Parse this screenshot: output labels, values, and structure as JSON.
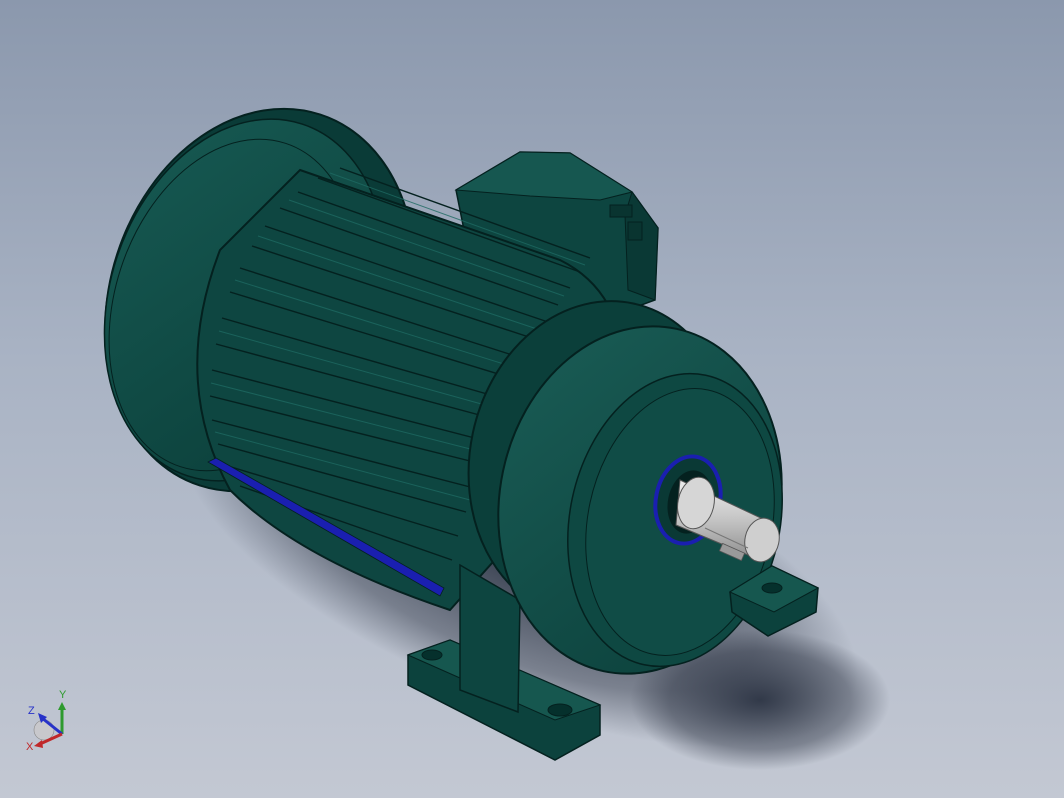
{
  "viewport": {
    "background_top": "#8b98ad",
    "background_bottom": "#c3c8d3"
  },
  "model": {
    "body_color": "#0f4a44",
    "body_light": "#1b5e57",
    "body_dark": "#083431",
    "edge_color": "#04211f",
    "accent_strip_color": "#1a1fb0",
    "shaft_color": "#c9c9c9",
    "seal_color": "#1a1fb0"
  },
  "triad": {
    "x_label": "X",
    "y_label": "Y",
    "z_label": "Z",
    "x_color": "#c0282a",
    "y_color": "#2e9a2e",
    "z_color": "#2732c8"
  }
}
